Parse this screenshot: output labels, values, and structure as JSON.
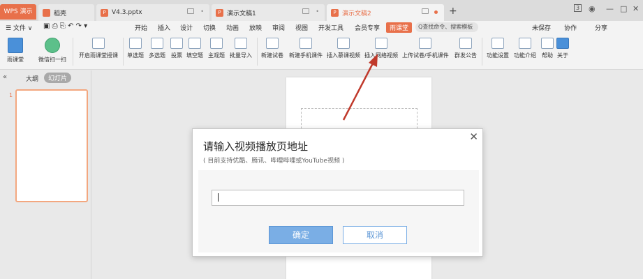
{
  "tabs": {
    "logo": "WPS 演示",
    "items": [
      {
        "label": "稻壳"
      },
      {
        "label": "V4.3.pptx",
        "icon": "P"
      },
      {
        "label": "演示文稿1",
        "icon": "P"
      },
      {
        "label": "演示文稿2",
        "icon": "P"
      }
    ],
    "new_tab": "+",
    "window": {
      "badge": "3",
      "minimize": "—",
      "restore": "□",
      "close": "✕"
    }
  },
  "menu": {
    "file": "☰ 文件 ∨",
    "items": [
      "开始",
      "插入",
      "设计",
      "切换",
      "动画",
      "放映",
      "审阅",
      "视图",
      "开发工具",
      "会员专享"
    ],
    "special": "雨课堂",
    "search": "Q查找命令、搜索模板",
    "right": [
      "未保存",
      "协作",
      "分享"
    ]
  },
  "ribbon": {
    "items": [
      "雨课堂",
      "微信扫一扫",
      "开启雨课堂授课",
      "单选题",
      "多选题",
      "投票",
      "填空题",
      "主观题",
      "批量导入",
      "新建试卷",
      "新建手机课件",
      "插入慕课视频",
      "插入网络视频",
      "上传试卷/手机课件",
      "群发公告",
      "功能设置",
      "功能介绍",
      "帮助",
      "关于"
    ]
  },
  "panel": {
    "collapse": "«",
    "outline": "大纲",
    "slides": "幻灯片",
    "slide_number": "1"
  },
  "dialog": {
    "title": "请输入视频播放页地址",
    "subtitle": "( 目前支持优酷、腾讯、哔哩哔哩或YouTube视频 )",
    "input_value": "",
    "ok": "确定",
    "cancel": "取消",
    "close": "✕"
  },
  "colors": {
    "accent": "#e8704a",
    "primary_button": "#7aaee5",
    "arrow": "#c0392b"
  }
}
